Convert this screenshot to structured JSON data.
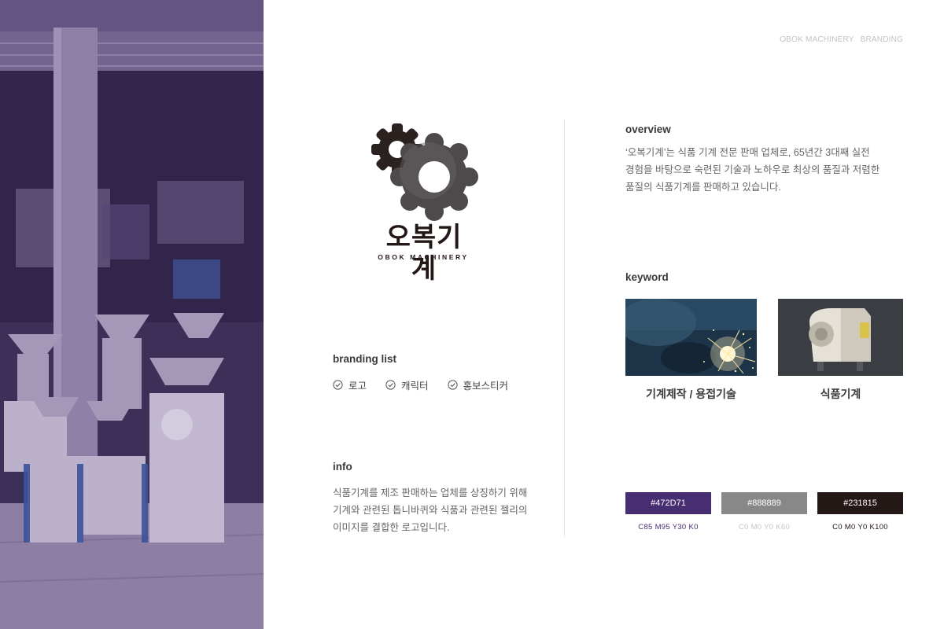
{
  "header": {
    "brand": "OBOK MACHINERY",
    "section": "BRANDING"
  },
  "logo": {
    "wordmark": "오복기계",
    "subtitle": "OBOK MACHINERY"
  },
  "branding": {
    "title": "branding list",
    "items": [
      "로고",
      "캐릭터",
      "홍보스티커"
    ]
  },
  "info": {
    "title": "info",
    "lines": [
      "식품기계를 제조 판매하는 업체를 상징하기 위해",
      "기계와 관련된 톱니바퀴와 식품과 관련된 젤리의",
      "이미지를 결합한 로고입니다."
    ]
  },
  "overview": {
    "title": "overview",
    "lines": [
      "‘오복기계’는 식품 기계 전문 판매 업체로, 65년간 3대째 실전",
      "경험을 바탕으로 숙련된 기술과 노하우로 최상의 품질과 저렴한",
      "품질의 식품기계를 판매하고 있습니다."
    ]
  },
  "keyword": {
    "title": "keyword",
    "items": [
      {
        "label": "기계제작 / 용접기술",
        "icon": "welding-photo"
      },
      {
        "label": "식품기계",
        "icon": "food-machine-photo"
      }
    ]
  },
  "colors": [
    {
      "hex": "#472D71",
      "cmyk": "C85 M95 Y30 K0",
      "code_color": "#472D71"
    },
    {
      "hex": "#888889",
      "cmyk": "C0 M0 Y0  K60",
      "code_color": "#c4c4c4"
    },
    {
      "hex": "#231815",
      "cmyk": "C0 M0 Y0 K100",
      "code_color": "#231815"
    }
  ]
}
